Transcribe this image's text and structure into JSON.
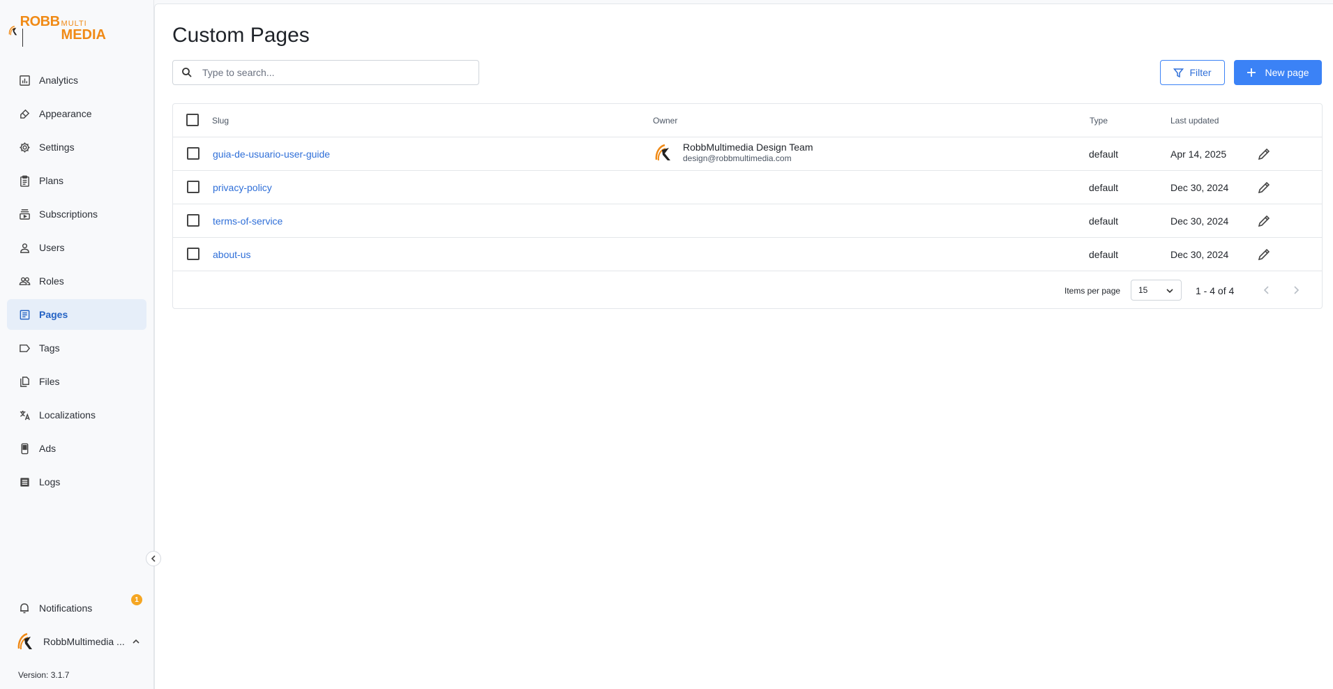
{
  "brand": {
    "logo_alt": "RobbMultimedia",
    "logo_text_primary": "ROBB",
    "logo_text_secondary": "MULTI",
    "logo_text_tertiary": "MEDIA",
    "accent": "#f08a16"
  },
  "sidebar": {
    "items": [
      {
        "label": "Analytics",
        "icon": "analytics-icon",
        "active": false
      },
      {
        "label": "Appearance",
        "icon": "brush-icon",
        "active": false
      },
      {
        "label": "Settings",
        "icon": "gear-icon",
        "active": false
      },
      {
        "label": "Plans",
        "icon": "clipboard-icon",
        "active": false
      },
      {
        "label": "Subscriptions",
        "icon": "subscriptions-icon",
        "active": false
      },
      {
        "label": "Users",
        "icon": "user-icon",
        "active": false
      },
      {
        "label": "Roles",
        "icon": "users-icon",
        "active": false
      },
      {
        "label": "Pages",
        "icon": "document-icon",
        "active": true
      },
      {
        "label": "Tags",
        "icon": "tag-icon",
        "active": false
      },
      {
        "label": "Files",
        "icon": "files-icon",
        "active": false
      },
      {
        "label": "Localizations",
        "icon": "translate-icon",
        "active": false
      },
      {
        "label": "Ads",
        "icon": "phone-icon",
        "active": false
      },
      {
        "label": "Logs",
        "icon": "list-icon",
        "active": false
      }
    ],
    "notifications_label": "Notifications",
    "notifications_count": "1",
    "user_name": "RobbMultimedia ...",
    "version": "Version: 3.1.7"
  },
  "main": {
    "title": "Custom Pages",
    "search_placeholder": "Type to search...",
    "filter_label": "Filter",
    "new_page_label": "New page",
    "columns": {
      "slug": "Slug",
      "owner": "Owner",
      "type": "Type",
      "last_updated": "Last updated"
    },
    "rows": [
      {
        "slug": "guia-de-usuario-user-guide",
        "owner_name": "RobbMultimedia Design Team",
        "owner_email": "design@robbmultimedia.com",
        "type": "default",
        "updated": "Apr 14, 2025"
      },
      {
        "slug": "privacy-policy",
        "owner_name": "",
        "owner_email": "",
        "type": "default",
        "updated": "Dec 30, 2024"
      },
      {
        "slug": "terms-of-service",
        "owner_name": "",
        "owner_email": "",
        "type": "default",
        "updated": "Dec 30, 2024"
      },
      {
        "slug": "about-us",
        "owner_name": "",
        "owner_email": "",
        "type": "default",
        "updated": "Dec 30, 2024"
      }
    ],
    "pager": {
      "items_per_page_label": "Items per page",
      "items_per_page_value": "15",
      "range": "1 - 4 of 4"
    }
  },
  "colors": {
    "primary": "#3b82f6",
    "link": "#2f6fd8",
    "active_bg": "#e6eef9",
    "badge": "#f5a623"
  }
}
